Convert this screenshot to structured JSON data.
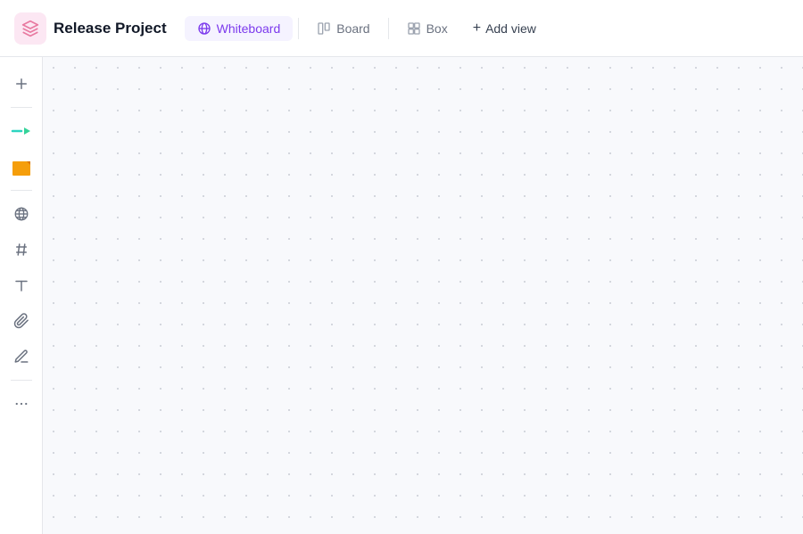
{
  "header": {
    "project_title": "Release Project",
    "project_icon_alt": "cube-icon",
    "tabs": [
      {
        "id": "whiteboard",
        "label": "Whiteboard",
        "icon": "globe-icon",
        "active": true
      },
      {
        "id": "board",
        "label": "Board",
        "icon": "board-icon",
        "active": false
      },
      {
        "id": "box",
        "label": "Box",
        "icon": "box-icon",
        "active": false
      }
    ],
    "add_view_label": "Add view"
  },
  "sidebar": {
    "tools": [
      {
        "id": "add",
        "icon": "+",
        "label": "add-tool"
      },
      {
        "id": "cursor",
        "icon": "cursor",
        "label": "cursor-tool"
      },
      {
        "id": "sticky",
        "icon": "sticky",
        "label": "sticky-tool"
      },
      {
        "id": "globe",
        "icon": "⊕",
        "label": "globe-tool"
      },
      {
        "id": "hashtag",
        "icon": "#",
        "label": "hashtag-tool"
      },
      {
        "id": "text",
        "icon": "T",
        "label": "text-tool"
      },
      {
        "id": "attach",
        "icon": "attach",
        "label": "attach-tool"
      },
      {
        "id": "draw",
        "icon": "draw",
        "label": "draw-tool"
      },
      {
        "id": "more",
        "icon": "···",
        "label": "more-tool"
      }
    ]
  },
  "canvas": {
    "background": "#f8f9fc",
    "dot_color": "#c8ccd4"
  },
  "colors": {
    "accent": "#7c3aed",
    "active_tab_bg": "#f5f3ff",
    "header_bg": "#ffffff",
    "sidebar_bg": "#ffffff",
    "canvas_bg": "#f8f9fc",
    "sticky_color": "#f59e0b"
  }
}
